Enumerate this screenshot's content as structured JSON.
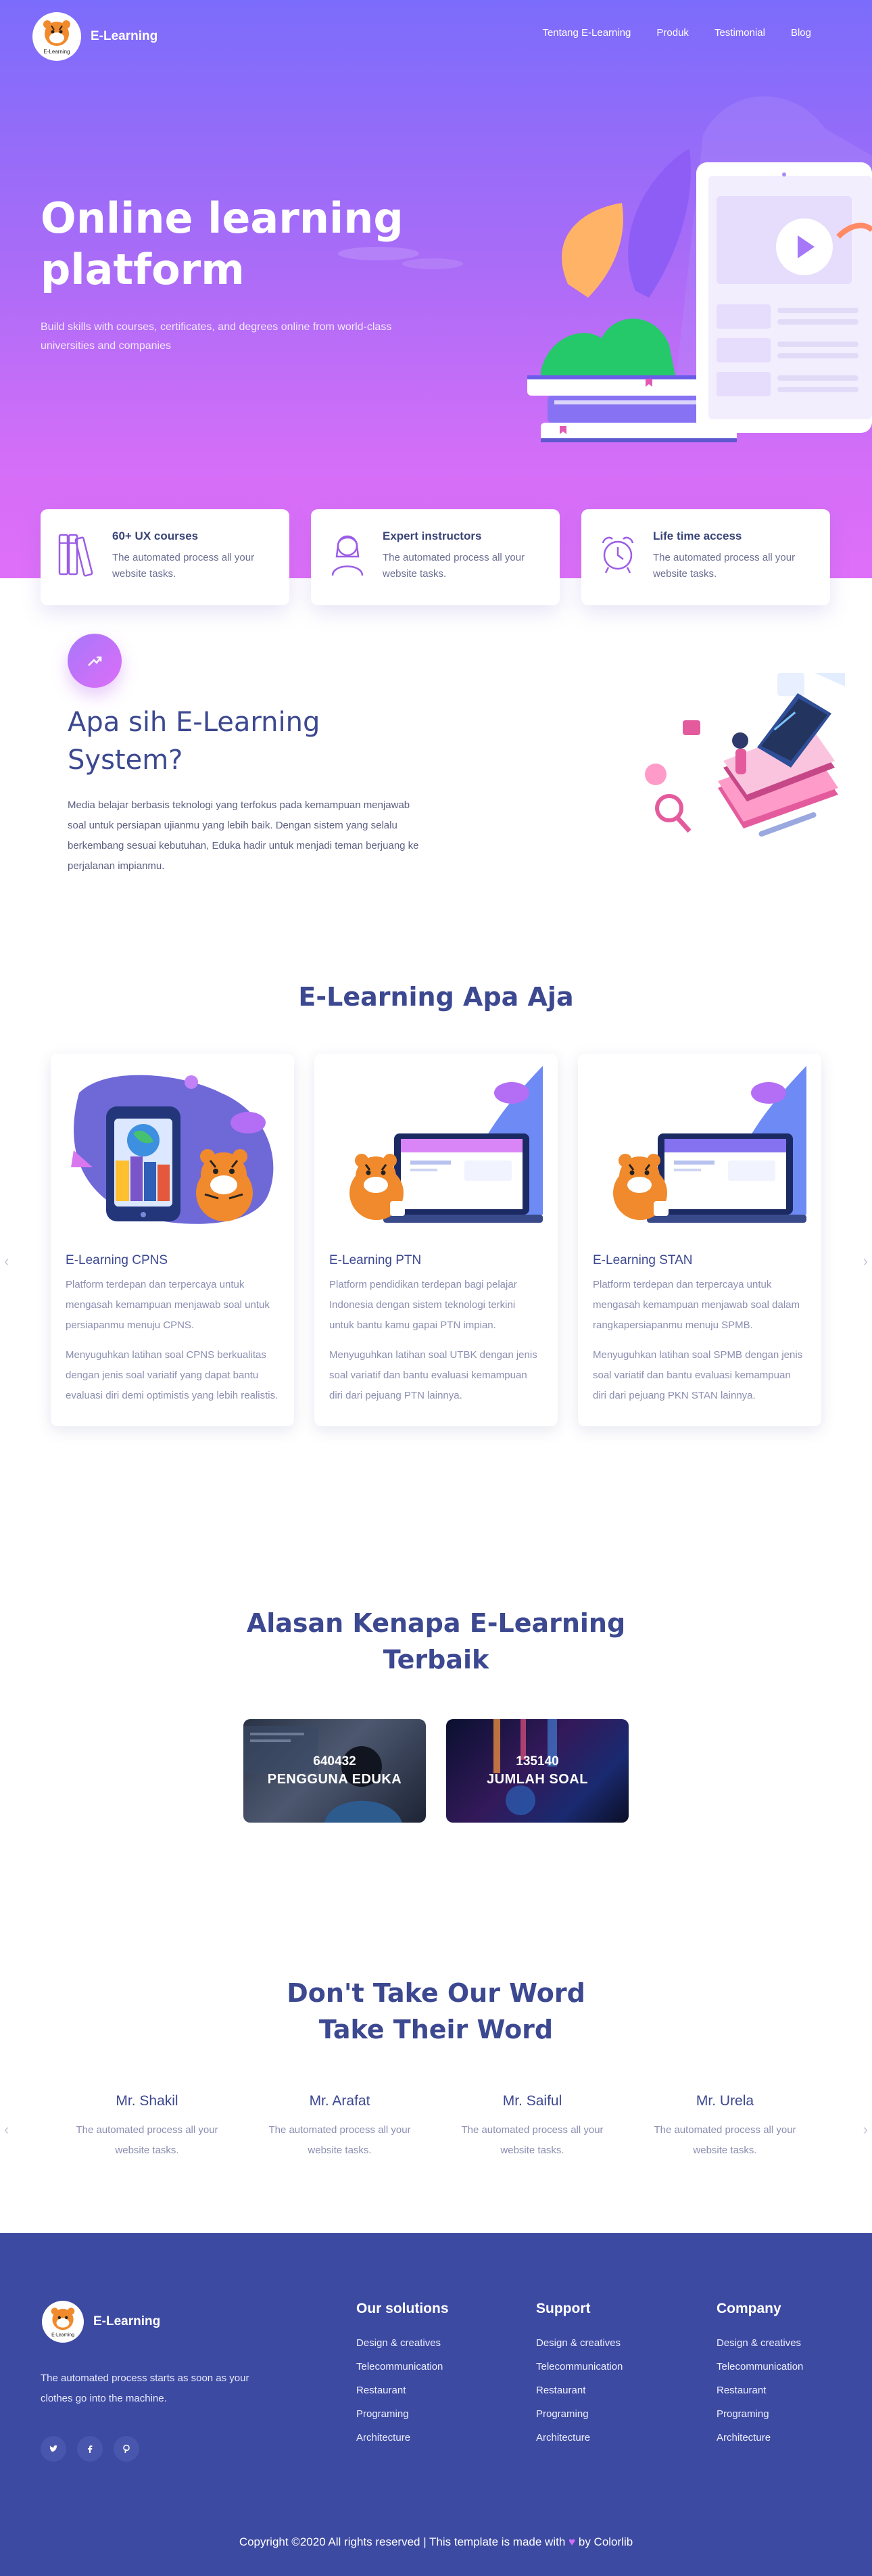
{
  "brand": {
    "name": "E-Learning",
    "logo_caption": "E-Learning"
  },
  "nav": {
    "items": [
      "Tentang E-Learning",
      "Produk",
      "Testimonial",
      "Blog"
    ]
  },
  "hero": {
    "title_line1": "Online learning",
    "title_line2": "platform",
    "subtitle": "Build skills with courses, certificates, and degrees online from world-class universities and companies"
  },
  "features": [
    {
      "title": "60+ UX courses",
      "desc": "The automated process all your website tasks.",
      "icon": "books-icon"
    },
    {
      "title": "Expert instructors",
      "desc": "The automated process all your website tasks.",
      "icon": "instructor-icon"
    },
    {
      "title": "Life time access",
      "desc": "The automated process all your website tasks.",
      "icon": "alarm-clock-icon"
    }
  ],
  "about": {
    "badge_icon": "trend-arrow-icon",
    "title": "Apa sih E-Learning System?",
    "text": "Media belajar berbasis teknologi yang terfokus pada kemampuan menjawab soal untuk persiapan ujianmu yang lebih baik. Dengan sistem yang selalu berkembang sesuai kebutuhan, Eduka hadir untuk menjadi teman berjuang ke perjalanan impianmu."
  },
  "products": {
    "title": "E-Learning Apa Aja",
    "prev_icon": "chevron-left-icon",
    "next_icon": "chevron-right-icon",
    "items": [
      {
        "title": "E-Learning CPNS",
        "p1": "Platform terdepan dan terpercaya untuk mengasah kemampuan menjawab soal untuk persiapanmu menuju CPNS.",
        "p2": "Menyuguhkan latihan soal CPNS berkualitas dengan jenis soal variatif yang dapat bantu evaluasi diri demi optimistis yang lebih realistis."
      },
      {
        "title": "E-Learning PTN",
        "p1": "Platform pendidikan terdepan bagi pelajar Indonesia dengan sistem teknologi terkini untuk bantu kamu gapai PTN impian.",
        "p2": "Menyuguhkan latihan soal UTBK dengan jenis soal variatif dan bantu evaluasi kemampuan diri dari pejuang PTN lainnya."
      },
      {
        "title": "E-Learning STAN",
        "p1": "Platform terdepan dan terpercaya untuk mengasah kemampuan menjawab soal dalam rangkapersiapanmu menuju SPMB.",
        "p2": "Menyuguhkan latihan soal SPMB dengan jenis soal variatif dan bantu evaluasi kemampuan diri dari pejuang PKN STAN lainnya."
      }
    ]
  },
  "reasons": {
    "title_line1": "Alasan Kenapa E-Learning",
    "title_line2": "Terbaik",
    "stats": [
      {
        "number": "640432",
        "label": "PENGGUNA EDUKA"
      },
      {
        "number": "135140",
        "label": "JUMLAH SOAL"
      }
    ]
  },
  "testimonials": {
    "title_line1": "Don't Take Our Word",
    "title_line2": "Take Their Word",
    "items": [
      {
        "name": "Mr. Shakil",
        "text": "The automated process all your website tasks."
      },
      {
        "name": "Mr. Arafat",
        "text": "The automated process all your website tasks."
      },
      {
        "name": "Mr. Saiful",
        "text": "The automated process all your website tasks."
      },
      {
        "name": "Mr. Urela",
        "text": "The automated process all your website tasks."
      }
    ]
  },
  "footer": {
    "brand": "E-Learning",
    "desc": "The automated process starts as soon as your clothes go into the machine.",
    "social": [
      "twitter-icon",
      "facebook-icon",
      "pinterest-icon"
    ],
    "columns": [
      {
        "title": "Our solutions",
        "links": [
          "Design & creatives",
          "Telecommunication",
          "Restaurant",
          "Programing",
          "Architecture"
        ]
      },
      {
        "title": "Support",
        "links": [
          "Design & creatives",
          "Telecommunication",
          "Restaurant",
          "Programing",
          "Architecture"
        ]
      },
      {
        "title": "Company",
        "links": [
          "Design & creatives",
          "Telecommunication",
          "Restaurant",
          "Programing",
          "Architecture"
        ]
      }
    ],
    "copyright_before": "Copyright ©2020 All rights reserved | This template is made with",
    "copyright_after": "by Colorlib"
  },
  "colors": {
    "accent": "#3c4890",
    "footer_bg": "#3d4aa2",
    "hero_start": "#7c6cfb",
    "hero_end": "#df6ff8"
  }
}
